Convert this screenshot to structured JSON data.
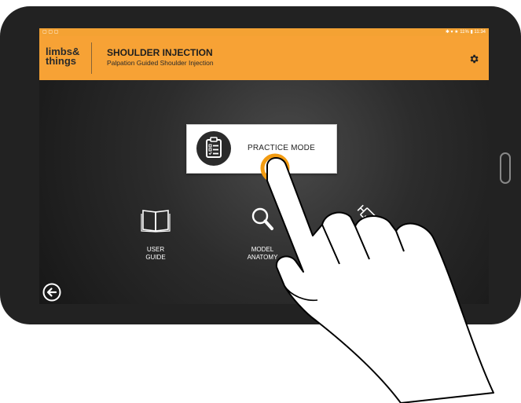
{
  "status_bar": {
    "left_icons": "▢ ▢ ▢",
    "right_text": "✱ ▾ ★ 11% ▮ 11:34"
  },
  "header": {
    "logo_line1": "limbs&",
    "logo_line2": "things",
    "title": "SHOULDER INJECTION",
    "subtitle": "Palpation Guided Shoulder Injection",
    "settings_icon": "gear-icon"
  },
  "modes": {
    "practice_label": "PRACTICE MODE",
    "user_guide_line1": "USER",
    "user_guide_line2": "GUIDE",
    "model_anatomy_line1": "MODEL",
    "model_anatomy_line2": "ANATOMY"
  },
  "navigation": {
    "back_icon": "back-arrow-icon"
  },
  "colors": {
    "accent": "#f7a235",
    "screen_bg": "#222222",
    "touch_ring": "#f39c12"
  }
}
